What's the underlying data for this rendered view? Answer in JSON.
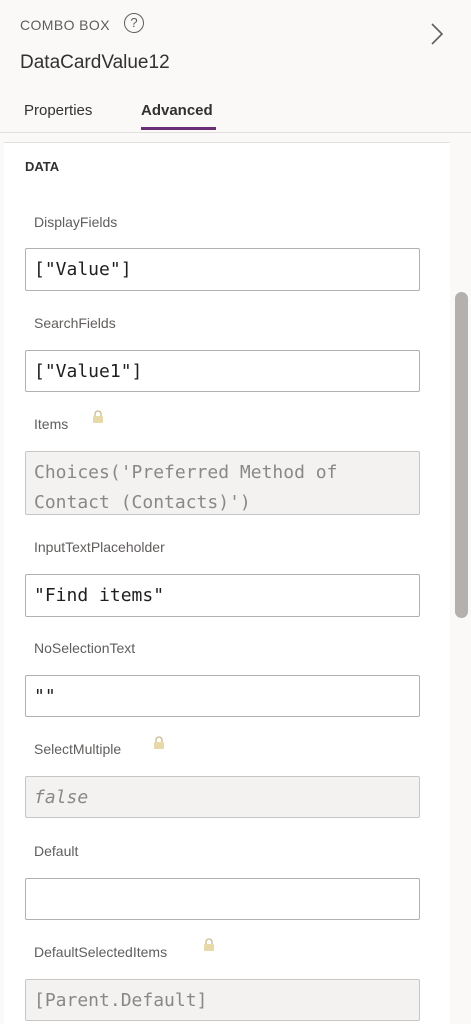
{
  "header": {
    "control_type": "COMBO BOX",
    "help_glyph": "?",
    "control_name": "DataCardValue12"
  },
  "tabs": [
    {
      "label": "Properties",
      "active": false
    },
    {
      "label": "Advanced",
      "active": true
    }
  ],
  "section": {
    "title": "DATA"
  },
  "properties": [
    {
      "label": "DisplayFields",
      "value": "[\"Value\"]",
      "locked": false
    },
    {
      "label": "SearchFields",
      "value": "[\"Value1\"]",
      "locked": false
    },
    {
      "label": "Items",
      "value": "Choices('Preferred Method of Contact (Contacts)')",
      "locked": true
    },
    {
      "label": "InputTextPlaceholder",
      "value": "\"Find items\"",
      "locked": false
    },
    {
      "label": "NoSelectionText",
      "value": "\"\"",
      "locked": false
    },
    {
      "label": "SelectMultiple",
      "value": "false",
      "locked": true
    },
    {
      "label": "Default",
      "value": "",
      "locked": false
    },
    {
      "label": "DefaultSelectedItems",
      "value": "[Parent.Default]",
      "locked": true
    }
  ],
  "colors": {
    "accent": "#6b2d75",
    "locked_field_bg": "#f3f2f1"
  },
  "icons": {
    "help": "help-circle-icon",
    "chevron": "chevron-right-icon",
    "lock": "lock-icon"
  }
}
